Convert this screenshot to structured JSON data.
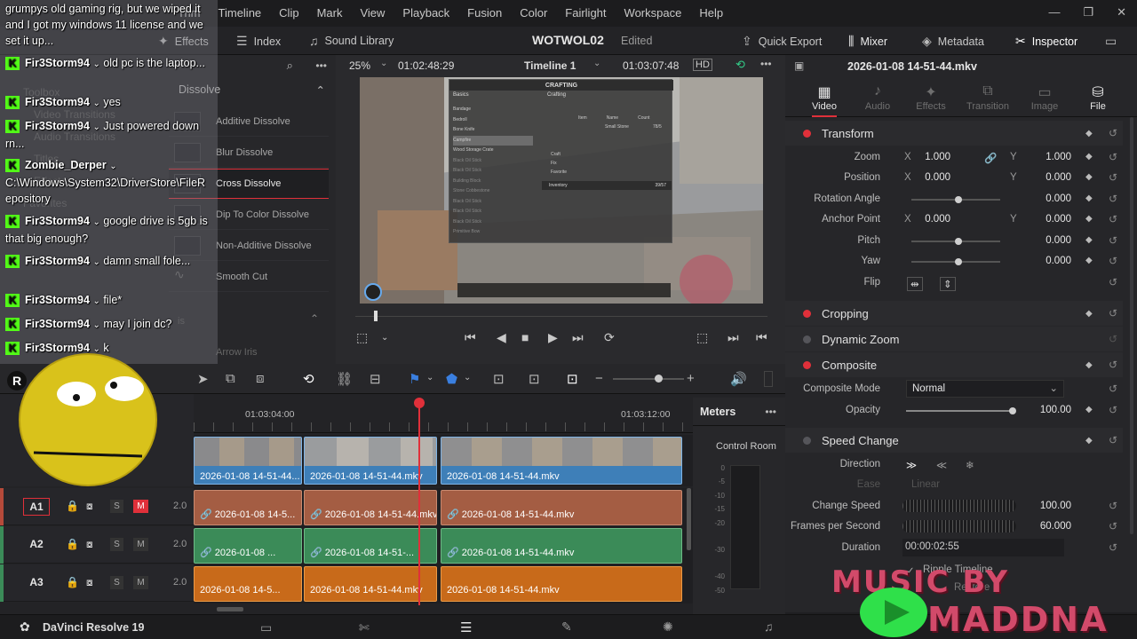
{
  "menu": {
    "items": [
      "Trim",
      "Timeline",
      "Clip",
      "Mark",
      "View",
      "Playback",
      "Fusion",
      "Color",
      "Fairlight",
      "Workspace",
      "Help"
    ]
  },
  "window": {
    "minimize": "—",
    "restore": "❐",
    "close": "✕"
  },
  "toolbar": {
    "effects": "Effects",
    "index": "Index",
    "sound_library": "Sound Library",
    "project": "WOTWOL02",
    "status": "Edited",
    "quick_export": "Quick Export",
    "mixer": "Mixer",
    "metadata": "Metadata",
    "inspector": "Inspector"
  },
  "effects": {
    "group": "Dissolve",
    "ghost_labels": [
      "Toolbox",
      "Video Transitions",
      "Audio Transitions",
      "Titles",
      "Effects",
      "Favorites"
    ],
    "items": [
      "Additive Dissolve",
      "Blur Dissolve",
      "Cross Dissolve",
      "Dip To Color Dissolve",
      "Non-Additive Dissolve",
      "Smooth Cut"
    ],
    "selected": "Cross Dissolve",
    "next": "Arrow Iris",
    "partial": "is"
  },
  "chat": {
    "messages": [
      {
        "user": "",
        "text": "grumpys old gaming rig, but we wiped it and I got my windows 11 license and we set it up..."
      },
      {
        "user": "Fir3Storm94",
        "text": "old pc is the laptop..."
      },
      {
        "user": "Fir3Storm94",
        "text": "yes"
      },
      {
        "user": "Fir3Storm94",
        "text": "Just powered down rn..."
      },
      {
        "user": "Zombie_Derper",
        "text": "C:\\Windows\\System32\\DriverStore\\FileRepository"
      },
      {
        "user": "Fir3Storm94",
        "text": "google drive is 5gb is that big enough?"
      },
      {
        "user": "Fir3Storm94",
        "text": "damn small fole..."
      },
      {
        "user": "Fir3Storm94",
        "text": "file*"
      },
      {
        "user": "Fir3Storm94",
        "text": "may I join dc?"
      },
      {
        "user": "Fir3Storm94",
        "text": "k"
      }
    ]
  },
  "viewer": {
    "zoom": "25%",
    "source_tc": "01:02:48:29",
    "timeline": "Timeline 1",
    "record_tc": "01:03:07:48",
    "game": {
      "tabs": [
        "CRAFTING"
      ],
      "basics": "Basics",
      "crafting": "Crafting",
      "recipes": [
        "Bandage",
        "Bedroll",
        "Bone Knife",
        "Campfire",
        "Wood Storage Crate",
        "Black Oil Stick",
        "Black Oil Stick",
        "Building Block",
        "Stone Cobbestone",
        "Black Oil Stick",
        "Black Oil Stick",
        "Black Oil Stick",
        "Primitive Bow"
      ],
      "cols": [
        "Item",
        "Name",
        "Count"
      ],
      "row": "Small Stone",
      "row_count": "78/5",
      "craft_opts": [
        "Craft",
        "Fix",
        "Favorite"
      ],
      "inventory": "Inventory",
      "inv_count": "39/57"
    }
  },
  "inspector": {
    "clip_name": "2026-01-08 14-51-44.mkv",
    "tabs": [
      {
        "label": "Video",
        "on": true
      },
      {
        "label": "Audio",
        "on": false
      },
      {
        "label": "Effects",
        "on": false
      },
      {
        "label": "Transition",
        "on": false
      },
      {
        "label": "Image",
        "on": false
      },
      {
        "label": "File",
        "on": true
      }
    ],
    "transform": "Transform",
    "zoom_label": "Zoom",
    "zoom_x": "1.000",
    "zoom_y": "1.000",
    "position_label": "Position",
    "pos_x": "0.000",
    "pos_y": "0.000",
    "rotation_label": "Rotation Angle",
    "rotation": "0.000",
    "anchor_label": "Anchor Point",
    "anchor_x": "0.000",
    "anchor_y": "0.000",
    "pitch_label": "Pitch",
    "pitch": "0.000",
    "yaw_label": "Yaw",
    "yaw": "0.000",
    "flip_label": "Flip",
    "cropping": "Cropping",
    "dynamic_zoom": "Dynamic Zoom",
    "composite": "Composite",
    "composite_mode_label": "Composite Mode",
    "composite_mode": "Normal",
    "opacity_label": "Opacity",
    "opacity": "100.00",
    "speed_change": "Speed Change",
    "direction_label": "Direction",
    "ease_label": "Ease",
    "ease": "Linear",
    "change_speed_label": "Change Speed",
    "change_speed": "100.00",
    "fps_label": "Frames per Second",
    "fps": "60.000",
    "duration_label": "Duration",
    "duration": "00:00:02:55",
    "ripple": "Ripple Timeline",
    "restore": "Restore"
  },
  "timeline": {
    "ruler": [
      "01:03:04:00",
      "01:03:12:00"
    ],
    "video_clips": [
      "2026-01-08 14-51-44...",
      "2026-01-08 14-51-44.mkv",
      "2026-01-08 14-51-44.mkv"
    ],
    "tracks": [
      {
        "name": "A1",
        "level": "2.0",
        "clips": [
          "2026-01-08 14-5...",
          "2026-01-08 14-51-44.mkv",
          "2026-01-08 14-51-44.mkv"
        ]
      },
      {
        "name": "A2",
        "level": "2.0",
        "clips": [
          "2026-01-08 ...",
          "2026-01-08 14-51-...",
          "2026-01-08 14-51-44.mkv"
        ]
      },
      {
        "name": "A3",
        "level": "2.0",
        "clips": [
          "2026-01-08 14-5...",
          "2026-01-08 14-51-44.mkv",
          "2026-01-08 14-51-44.mkv"
        ]
      }
    ],
    "solo": "S",
    "mute": "M"
  },
  "meters": {
    "title": "Meters",
    "control_room": "Control Room",
    "scale": [
      "0",
      "-5",
      "-10",
      "-15",
      "-20",
      "-30",
      "-40",
      "-50"
    ]
  },
  "status": {
    "app": "DaVinci Resolve 19"
  },
  "overlay": {
    "letter": "R",
    "music1": "MUSIC BY",
    "music2": "MADDNA"
  },
  "colors": {
    "accent": "#e0303a",
    "kick": "#53fc18",
    "video_clip": "#3e7fb8",
    "a1": "#a45d43",
    "a2": "#3b8b58",
    "a3": "#c86a1a"
  }
}
